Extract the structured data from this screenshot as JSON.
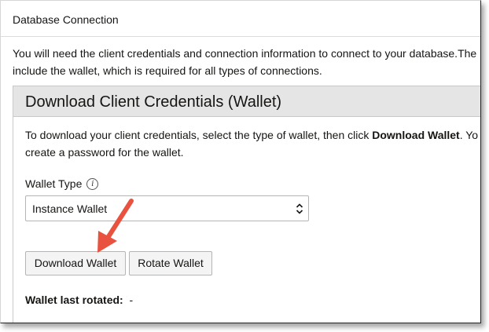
{
  "dialog": {
    "title": "Database Connection",
    "intro_line1": "You will need the client credentials and connection information to connect to your database.The",
    "intro_line2": "include the wallet, which is required for all types of connections."
  },
  "panel": {
    "title": "Download Client Credentials (Wallet)",
    "text_line1_prefix": "To download your client credentials, select the type of wallet, then click ",
    "text_line1_bold": "Download Wallet",
    "text_line1_suffix": ". Yo",
    "text_line2": "create a password for the wallet.",
    "wallet_type_label": "Wallet Type",
    "info_icon": "i",
    "wallet_type_value": "Instance Wallet",
    "download_button": "Download Wallet",
    "rotate_button": "Rotate Wallet",
    "last_rotated_label": "Wallet last rotated:",
    "last_rotated_value": "-"
  },
  "colors": {
    "arrow": "#e8523f",
    "panel_header_bg": "#e5e5e5"
  },
  "icons": {
    "info": "info-icon",
    "select_chevron": "chevron-up-down-icon",
    "annotation": "arrow-annotation-icon"
  }
}
